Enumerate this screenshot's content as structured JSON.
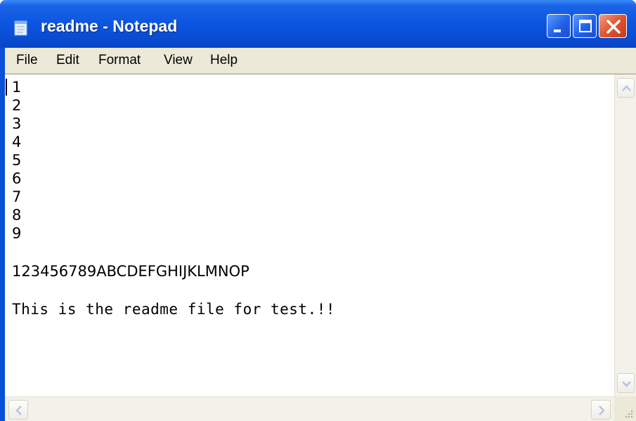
{
  "window": {
    "title": "readme - Notepad",
    "icon": "notepad-icon",
    "buttons": {
      "minimize": "minimize-icon",
      "maximize": "maximize-icon",
      "close": "close-icon"
    }
  },
  "menu": {
    "items": [
      {
        "label": "File"
      },
      {
        "label": "Edit"
      },
      {
        "label": "Format"
      },
      {
        "label": "View"
      },
      {
        "label": "Help"
      }
    ]
  },
  "document": {
    "lines": [
      "1",
      "2",
      "3",
      "4",
      "5",
      "6",
      "7",
      "8",
      "9",
      "",
      "123456789ABCDEFGHIJKLMNOP",
      "",
      "This is the readme file for test.!!"
    ]
  },
  "scrollbars": {
    "up": "scroll-up-icon",
    "down": "scroll-down-icon",
    "left": "scroll-left-icon",
    "right": "scroll-right-icon"
  },
  "colors": {
    "titlebar": "#0b55e0",
    "close": "#e2542f",
    "menubar": "#ece9d8"
  }
}
